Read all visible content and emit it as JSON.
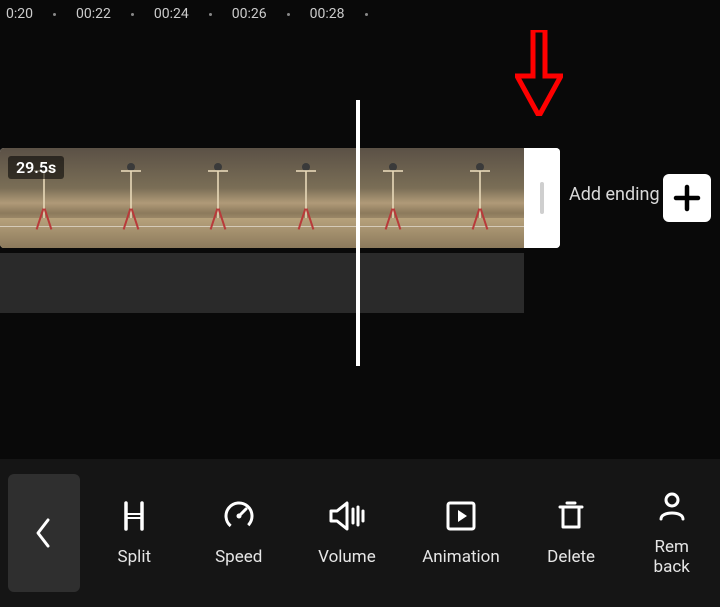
{
  "ruler": {
    "ticks": [
      "0:20",
      "00:22",
      "00:24",
      "00:26",
      "00:28"
    ]
  },
  "clip": {
    "duration_badge": "29.5s"
  },
  "add_ending_label": "Add ending",
  "toolbar_last_partial": "Rem\nback",
  "tools": [
    {
      "id": "split",
      "label": "Split"
    },
    {
      "id": "speed",
      "label": "Speed"
    },
    {
      "id": "volume",
      "label": "Volume"
    },
    {
      "id": "animation",
      "label": "Animation"
    },
    {
      "id": "delete",
      "label": "Delete"
    }
  ]
}
